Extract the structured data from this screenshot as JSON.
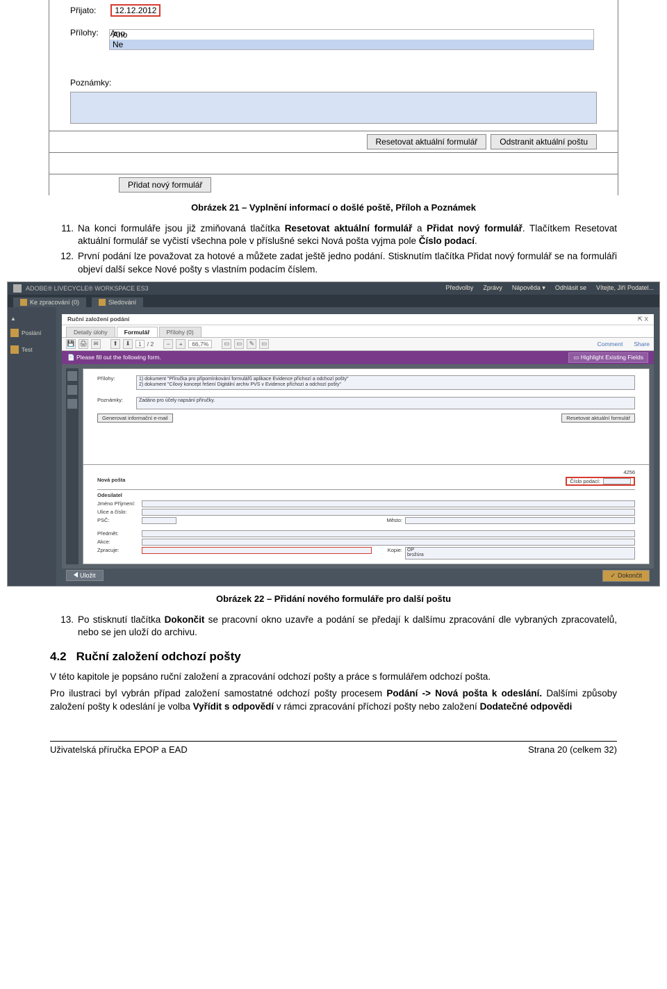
{
  "form1": {
    "prijato_label": "Přijato:",
    "prijato_value": "12.12.2012",
    "prilohy_label": "Přílohy:",
    "prilohy_opt1": "Ano",
    "prilohy_opt2": "Ne",
    "poznamky_label": "Poznámky:",
    "btn_reset": "Resetovat aktuální formulář",
    "btn_delete": "Odstranit aktuální poštu",
    "btn_add": "Přidat nový formulář"
  },
  "caption21": "Obrázek 21 – Vyplnění informací o došlé poště, Příloh a Poznámek",
  "item11_num": "11.",
  "item11_t1": "Na konci formuláře jsou již zmiňovaná tlačítka ",
  "item11_b1": "Resetovat aktuální formulář",
  "item11_t2": " a ",
  "item11_b2": "Přidat nový formulář",
  "item11_t3": ". Tlačítkem Resetovat aktuální formulář se vyčistí všechna pole v příslušné sekci Nová pošta vyjma pole ",
  "item11_b3": "Číslo podací",
  "item11_t4": ".",
  "item12_num": "12.",
  "item12_t1": "První podání lze považovat za hotové a můžete zadat ještě jedno podání. Stisknutím tlačítka Přidat nový formulář se na formuláři objeví další sekce Nové pošty s vlastním podacím číslem.",
  "lc": {
    "product": "ADOBE® LIVECYCLE® WORKSPACE ES3",
    "nav": {
      "predvolby": "Předvolby",
      "zpravy": "Zprávy",
      "napoveda": "Nápověda ▾",
      "odhlasit": "Odhlásit se",
      "user": "Vítejte, Jiří Podatel..."
    },
    "tabs": {
      "kezprac": "Ke zpracování (0)",
      "sledovani": "Sledování"
    },
    "sidebar": {
      "poslani": "Poslání",
      "test": "Test"
    },
    "panel_title": "Ruční založení podání",
    "doctabs": {
      "det": "Detaily úlohy",
      "form": "Formulář",
      "pril": "Přílohy (0)"
    },
    "toolbar": {
      "page_cur": "1",
      "page_sep": "/ 2",
      "zoom": "66,7%",
      "comment": "Comment",
      "share": "Share"
    },
    "infobar": {
      "msg": "Please fill out the following form.",
      "btn": "Highlight Existing Fields"
    },
    "doc": {
      "prilohy_lbl": "Přílohy:",
      "prilohy_l1": "1) dokument \"Příručka pro připomínkování formulářů aplikace Evidence příchozí a odchozí pošty\"",
      "prilohy_l2": "2) dokument \"Cílový koncept řešení Digitální archiv PVS v Evidence příchozí a odchozí pošty\"",
      "poznamky_lbl": "Poznámky:",
      "poznamky_val": "Zadáno pro účely napsání příručky.",
      "btn_send": "Generovat informační e-mail",
      "btn_reset": "Resetovat aktuální formulář",
      "footer_num": "4256",
      "np_title": "Nová pošta",
      "cislo_lbl": "Číslo podací:",
      "odesilatel": "Odesilatel",
      "jmenoprijm": "Jméno Příjmení:",
      "ulice": "Ulice a číslo:",
      "psc": "PSČ:",
      "mesto": "Město:",
      "predmet": "Předmět:",
      "akce": "Akce:",
      "zpracuje": "Zpracuje:",
      "kopie": "Kopie:",
      "kopie_val": "OP\nbrožúra"
    },
    "footer": {
      "ulozit": "Uložit",
      "dokoncit": "Dokončit"
    }
  },
  "caption22": "Obrázek 22 – Přidání nového formuláře pro další poštu",
  "item13_num": "13.",
  "item13_t1": "Po stisknutí tlačítka ",
  "item13_b1": "Dokončit",
  "item13_t2": " se pracovní okno uzavře a podání se předají k dalšímu zpracování dle vybraných zpracovatelů, nebo se jen uloží do archivu.",
  "sec42_num": "4.2",
  "sec42_title": "Ruční založení odchozí pošty",
  "p1": "V této kapitole je popsáno ruční založení a zpracování odchozí pošty a práce s formulářem odchozí pošta.",
  "p2a": "Pro ilustraci byl vybrán případ založení samostatné odchozí pošty procesem ",
  "p2b1": "Podání -> Nová pošta k odeslání.",
  "p2c": " Dalšími způsoby založení pošty k odeslání je volba ",
  "p2b2": "Vyřídit s odpovědí",
  "p2d": " v rámci zpracování příchozí pošty nebo založení ",
  "p2b3": "Dodatečné odpovědi",
  "footer": {
    "left": "Uživatelská příručka EPOP a EAD",
    "right": "Strana 20 (celkem 32)"
  }
}
